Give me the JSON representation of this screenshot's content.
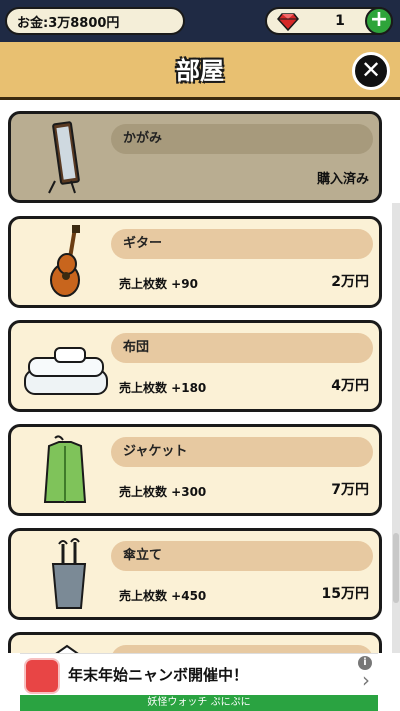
{
  "header": {
    "money_label": "お金:3万8800円",
    "gem_count": "1",
    "add_gems_label": "+"
  },
  "title_bar": {
    "title": "部屋",
    "close_label": "✕"
  },
  "items": [
    {
      "name": "かがみ",
      "status": "購入済み",
      "icon": "mirror-icon"
    },
    {
      "name": "ギター",
      "stat": "売上枚数 +90",
      "price": "2万円",
      "icon": "guitar-icon"
    },
    {
      "name": "布団",
      "stat": "売上枚数 +180",
      "price": "4万円",
      "icon": "futon-icon"
    },
    {
      "name": "ジャケット",
      "stat": "売上枚数 +300",
      "price": "7万円",
      "icon": "jacket-icon"
    },
    {
      "name": "傘立て",
      "stat": "売上枚数 +450",
      "price": "15万円",
      "icon": "umbrella-stand-icon"
    },
    {
      "name": "",
      "icon": "next-item-icon"
    }
  ],
  "ad": {
    "title": "年末年始ニャンボ開催中！",
    "footer": "妖怪ウォッチ ぷにぷに",
    "info_label": "i",
    "arrow_label": "›"
  },
  "colors": {
    "title_bar": "#e8c071",
    "card": "#fbf1d6",
    "card_owned": "#b9ad91",
    "name_pill": "#e7c9a1",
    "ad_green": "#2aa341"
  }
}
